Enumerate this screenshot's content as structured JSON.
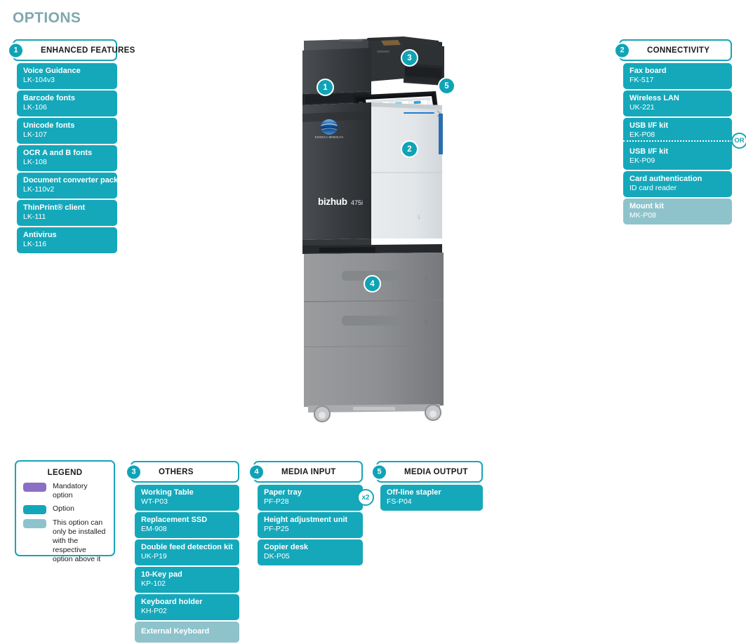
{
  "page": {
    "title": "OPTIONS"
  },
  "panels": {
    "enhanced_features": {
      "number": "1",
      "title": "ENHANCED FEATURES",
      "items": [
        {
          "name": "Voice Guidance",
          "code": "LK-104v3",
          "type": "option"
        },
        {
          "name": "Barcode fonts",
          "code": "LK-106",
          "type": "option"
        },
        {
          "name": "Unicode fonts",
          "code": "LK-107",
          "type": "option"
        },
        {
          "name": "OCR A and B fonts",
          "code": "LK-108",
          "type": "option"
        },
        {
          "name": "Document converter pack",
          "code": "LK-110v2",
          "type": "option"
        },
        {
          "name": "ThinPrint® client",
          "code": "LK-111",
          "type": "option"
        },
        {
          "name": "Antivirus",
          "code": "LK-116",
          "type": "option"
        }
      ]
    },
    "connectivity": {
      "number": "2",
      "title": "CONNECTIVITY",
      "or_label": "OR",
      "items": [
        {
          "name": "Fax board",
          "code": "FK-517",
          "type": "option"
        },
        {
          "name": "Wireless LAN",
          "code": "UK-221",
          "type": "option"
        },
        {
          "name": "USB I/F kit",
          "code": "EK-P08",
          "type": "option"
        },
        {
          "name": "USB I/F kit",
          "code": "EK-P09",
          "type": "option"
        },
        {
          "name": "Card authentication",
          "code": "ID card reader",
          "type": "option"
        },
        {
          "name": "Mount kit",
          "code": "MK-P08",
          "type": "dependent"
        }
      ]
    },
    "others": {
      "number": "3",
      "title": "OTHERS",
      "items": [
        {
          "name": "Working Table",
          "code": "WT-P03",
          "type": "option"
        },
        {
          "name": "Replacement SSD",
          "code": "EM-908",
          "type": "option"
        },
        {
          "name": "Double feed detection kit",
          "code": "UK-P19",
          "type": "option"
        },
        {
          "name": "10-Key pad",
          "code": "KP-102",
          "type": "option"
        },
        {
          "name": "Keyboard holder",
          "code": "KH-P02",
          "type": "option"
        },
        {
          "name": "External Keyboard",
          "code": "",
          "type": "dependent"
        }
      ]
    },
    "media_input": {
      "number": "4",
      "title": "MEDIA INPUT",
      "quantity_badge": "x2",
      "items": [
        {
          "name": "Paper tray",
          "code": "PF-P28",
          "type": "option"
        },
        {
          "name": "Height adjustment unit",
          "code": "PF-P25",
          "type": "option"
        },
        {
          "name": "Copier desk",
          "code": "DK-P05",
          "type": "option"
        }
      ]
    },
    "media_output": {
      "number": "5",
      "title": "MEDIA OUTPUT",
      "items": [
        {
          "name": "Off-line stapler",
          "code": "FS-P04",
          "type": "option"
        }
      ]
    }
  },
  "legend": {
    "title": "LEGEND",
    "rows": [
      {
        "color": "#8b6fc4",
        "label": "Mandatory option"
      },
      {
        "color": "#12a6ba",
        "label": "Option"
      },
      {
        "color": "#8ec3cc",
        "label": "This option can only be installed with the respective option above it"
      }
    ]
  },
  "printer": {
    "brand": "KONICA MINOLTA",
    "model_family": "bizhub",
    "model_number": "475i",
    "tray_labels": [
      "1",
      "2",
      "3"
    ],
    "callouts": [
      "1",
      "2",
      "3",
      "4",
      "5"
    ]
  },
  "colors": {
    "teal": "#15a8bb",
    "teal_border": "#17a5b6",
    "teal_badge": "#0fa3b5",
    "light_teal": "#8ec3cc",
    "purple": "#8b6fc4",
    "title_gray": "#7fa8b0"
  }
}
